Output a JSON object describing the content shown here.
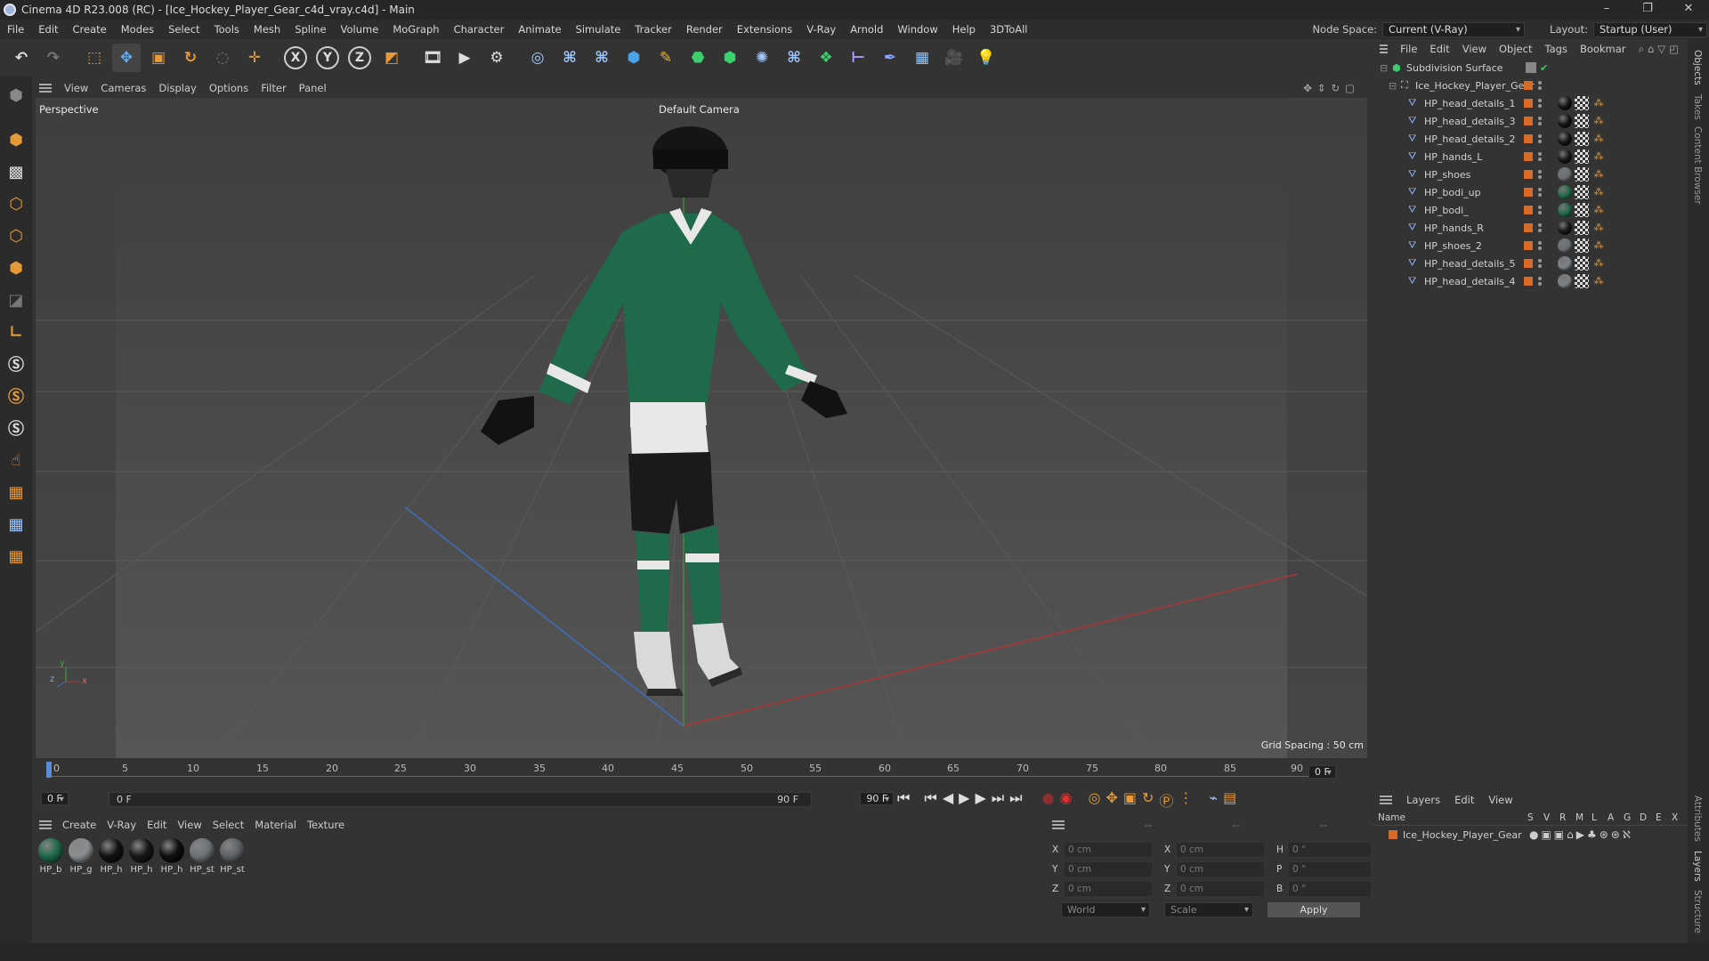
{
  "window": {
    "title": "Cinema 4D R23.008 (RC) - [Ice_Hockey_Player_Gear_c4d_vray.c4d] - Main"
  },
  "menu": [
    "File",
    "Edit",
    "Create",
    "Modes",
    "Select",
    "Tools",
    "Mesh",
    "Spline",
    "Volume",
    "MoGraph",
    "Character",
    "Animate",
    "Simulate",
    "Tracker",
    "Render",
    "Extensions",
    "V-Ray",
    "Arnold",
    "Window",
    "Help",
    "3DToAll"
  ],
  "node_space": {
    "label": "Node Space:",
    "value": "Current (V-Ray)"
  },
  "layout": {
    "label": "Layout:",
    "value": "Startup (User)"
  },
  "viewport": {
    "menu": [
      "View",
      "Cameras",
      "Display",
      "Options",
      "Filter",
      "Panel"
    ],
    "view_name": "Perspective",
    "camera": "Default Camera",
    "grid_spacing": "Grid Spacing : 50 cm"
  },
  "timeline": {
    "ticks": [
      "0",
      "5",
      "10",
      "15",
      "20",
      "25",
      "30",
      "35",
      "40",
      "45",
      "50",
      "55",
      "60",
      "65",
      "70",
      "75",
      "80",
      "85",
      "90"
    ],
    "current_frame": "0 F",
    "start": "0 F",
    "range_start": "0 F",
    "range_end": "90 F",
    "end": "90 F"
  },
  "materials": {
    "menu": [
      "Create",
      "V-Ray",
      "Edit",
      "View",
      "Select",
      "Material",
      "Texture"
    ],
    "items": [
      {
        "label": "HP_b",
        "color": "#1f6b4c"
      },
      {
        "label": "HP_g",
        "color": "#8a8d90"
      },
      {
        "label": "HP_h",
        "color": "#121212"
      },
      {
        "label": "HP_h",
        "color": "#161616"
      },
      {
        "label": "HP_h",
        "color": "#0e0e0e"
      },
      {
        "label": "HP_st",
        "color": "#6d7277"
      },
      {
        "label": "HP_st",
        "color": "#5d6166"
      }
    ]
  },
  "attributes": {
    "header": [
      "--",
      "--",
      "--"
    ],
    "rows": [
      {
        "a": "X",
        "av": "0 cm",
        "b": "X",
        "bv": "0 cm",
        "c": "H",
        "cv": "0 °"
      },
      {
        "a": "Y",
        "av": "0 cm",
        "b": "Y",
        "bv": "0 cm",
        "c": "P",
        "cv": "0 °"
      },
      {
        "a": "Z",
        "av": "0 cm",
        "b": "Z",
        "bv": "0 cm",
        "c": "B",
        "cv": "0 °"
      }
    ],
    "coord_mode": "World",
    "scale_mode": "Scale",
    "apply": "Apply"
  },
  "objects": {
    "menu": [
      "File",
      "Edit",
      "View",
      "Object",
      "Tags",
      "Bookmar"
    ],
    "root": "Subdivision Surface",
    "group": "Ice_Hockey_Player_Gear",
    "children": [
      {
        "name": "HP_head_details_1",
        "mat": "#111111"
      },
      {
        "name": "HP_head_details_3",
        "mat": "#111111"
      },
      {
        "name": "HP_head_details_2",
        "mat": "#111111"
      },
      {
        "name": "HP_hands_L",
        "mat": "#141414"
      },
      {
        "name": "HP_shoes",
        "mat": "#6a6f74"
      },
      {
        "name": "HP_bodi_up",
        "mat": "#1e6a4b"
      },
      {
        "name": "HP_bodi_",
        "mat": "#1e6a4b"
      },
      {
        "name": "HP_hands_R",
        "mat": "#141414"
      },
      {
        "name": "HP_shoes_2",
        "mat": "#6a6f74"
      },
      {
        "name": "HP_head_details_5",
        "mat": "#7d8186"
      },
      {
        "name": "HP_head_details_4",
        "mat": "#7d8186"
      }
    ]
  },
  "layers": {
    "menu": [
      "Layers",
      "Edit",
      "View"
    ],
    "columns": [
      "Name",
      "S",
      "V",
      "R",
      "M",
      "L",
      "A",
      "G",
      "D",
      "E",
      "X"
    ],
    "items": [
      {
        "name": "Ice_Hockey_Player_Gear",
        "color": "#d86a28"
      }
    ]
  },
  "side_tabs": [
    "Objects",
    "Takes",
    "Content Browser",
    "Attributes",
    "Layers",
    "Structure"
  ],
  "colors": {
    "accent_orange": "#d86a28",
    "jersey_green": "#1e6a4b"
  }
}
